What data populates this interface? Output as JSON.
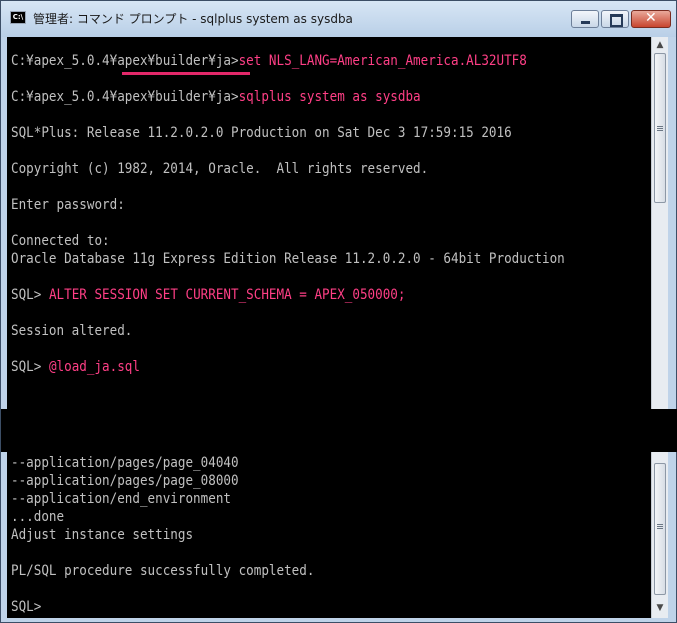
{
  "window": {
    "title": "管理者: コマンド プロンプト - sqlplus  system as sysdba",
    "icon_text": "C:\\"
  },
  "console": {
    "line1_prompt": "C:¥apex_5.0.4¥apex¥builder¥ja>",
    "line1_cmd": "set NLS_LANG=American_America.AL32UTF8",
    "line2_prompt": "C:¥apex_5.0.4¥apex¥builder¥ja>",
    "line2_cmd": "sqlplus system as sysdba",
    "banner": "SQL*Plus: Release 11.2.0.2.0 Production on Sat Dec 3 17:59:15 2016",
    "copyright": "Copyright (c) 1982, 2014, Oracle.  All rights reserved.",
    "enter_password": "Enter password:",
    "connected_to": "Connected to:",
    "db_version": "Oracle Database 11g Express Edition Release 11.2.0.2.0 - 64bit Production",
    "sql_prompt1": "SQL> ",
    "alter_cmd": "ALTER SESSION SET CURRENT_SCHEMA = APEX_050000;",
    "session_altered": "Session altered.",
    "sql_prompt2": "SQL> ",
    "load_cmd": "@load_ja.sql",
    "page_04040": "--application/pages/page_04040",
    "page_08000": "--application/pages/page_08000",
    "end_env": "--application/end_environment",
    "done": "...done",
    "adjust": "Adjust instance settings",
    "plsql_done": "PL/SQL procedure successfully completed.",
    "sql_prompt3": "SQL>"
  },
  "colors": {
    "console_bg": "#000000",
    "console_text": "#c0c0c0",
    "command_highlight": "#ff3f86",
    "underline": "#e3286a"
  }
}
